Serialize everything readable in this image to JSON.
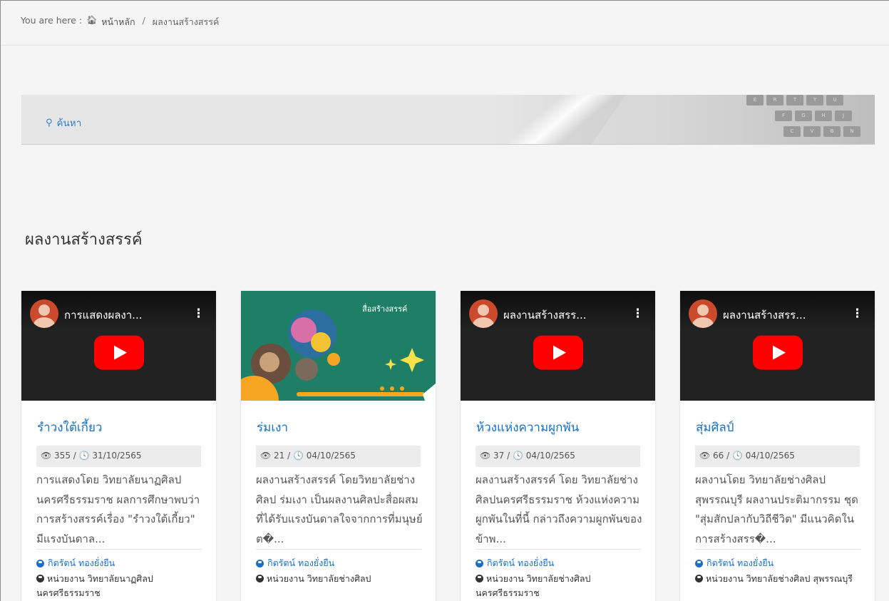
{
  "breadcrumb": {
    "prefix": "You are here :",
    "home": "หน้าหลัก",
    "separator": "/",
    "current": "ผลงานสร้างสรรค์"
  },
  "search": {
    "label": "ค้นหา",
    "icon": "search-icon"
  },
  "section_title": "ผลงานสร้างสรรค์",
  "colors": {
    "link": "#1a6fc2",
    "youtube_red": "#ff0000"
  },
  "cards": [
    {
      "thumb_type": "youtube",
      "video_title": "การแสดงผลงา...",
      "title": "รำวงใต้เกี้ยว",
      "meta": "👁 355 / 🕓 31/10/2565",
      "desc": "การแสดงโดย วิทยาลัยนาฏศิลป นครศรีธรรมราช ผลการศึกษาพบว่า การสร้างสรรค์เรื่อง \"รำวงใต้เกี้ยว\" มีแรงบันดาล...",
      "author": "กิตรัตน์ ทองยั่งยืน",
      "unit": "หน่วยงาน วิทยาลัยนาฏศิลป นครศรีธรรมราช"
    },
    {
      "thumb_type": "image",
      "image_caption": "สื่อสร้างสรรค์",
      "title": "ร่มเงา",
      "meta": "👁 21 / 🕓 04/10/2565",
      "desc": "ผลงานสร้างสรรค์ โดยวิทยาลัยช่างศิลป ร่มเงา เป็นผลงานศิลปะสื่อผสมที่ได้รับแรงบันดาลใจจากการที่มนุษย์ต�...",
      "author": "กิตรัตน์ ทองยั่งยืน",
      "unit": "หน่วยงาน วิทยาลัยช่างศิลป"
    },
    {
      "thumb_type": "youtube",
      "video_title": "ผลงานสร้างสรร...",
      "title": "ห้วงแห่งความผูกพัน",
      "meta": "👁 37 / 🕓 04/10/2565",
      "desc": "ผลงานสร้างสรรค์ โดย วิทยาลัยช่างศิลปนครศรีธรรมราช ห้วงแห่งความผูกพันในที่นี้ กล่าวถึงความผูกพันของข้าพ...",
      "author": "กิตรัตน์ ทองยั่งยืน",
      "unit": "หน่วยงาน วิทยาลัยช่างศิลป นครศรีธรรมราช"
    },
    {
      "thumb_type": "youtube",
      "video_title": "ผลงานสร้างสรร...",
      "title": "สุ่มศิลป์",
      "meta": "👁 66 / 🕓 04/10/2565",
      "desc": "ผลงานโดย วิทยาลัยช่างศิลป สุพรรณบุรี ผลงานประติมากรรม ชุด \"สุ่มสักปลากับวิถีชีวิต\" มีแนวคิดในการสร้างสรร�...",
      "author": "กิตรัตน์ ทองยั่งยืน",
      "unit": "หน่วยงาน วิทยาลัยช่างศิลป สุพรรณบุรี"
    }
  ]
}
